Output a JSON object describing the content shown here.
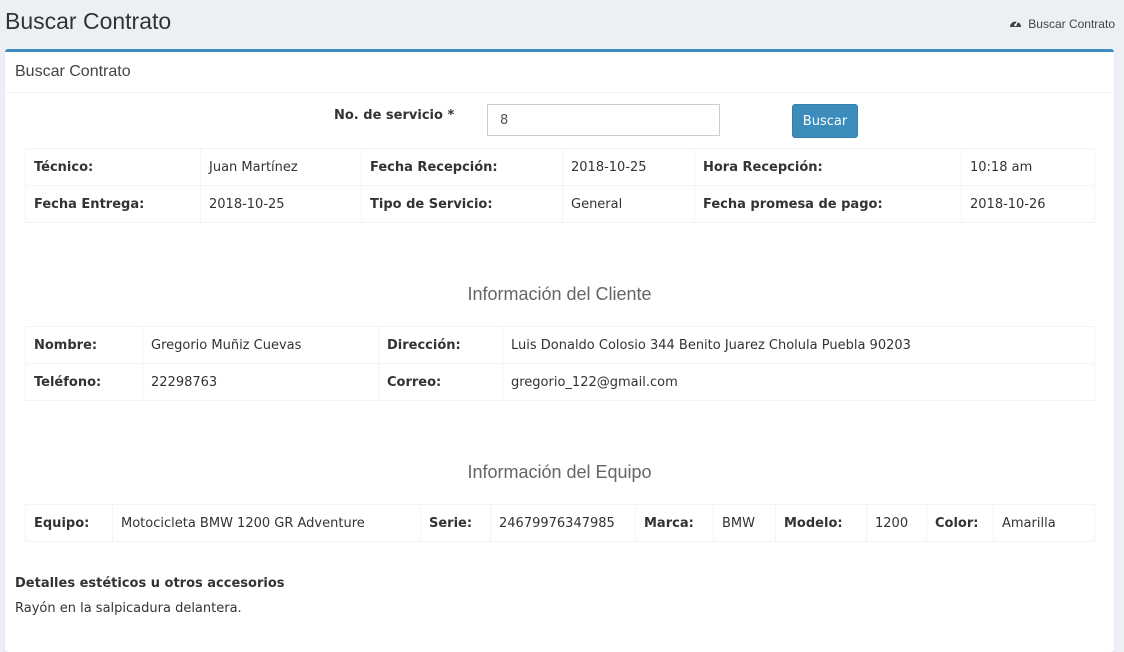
{
  "page": {
    "title": "Buscar Contrato",
    "breadcrumb": {
      "icon": "dashboard-icon",
      "label": "Buscar Contrato"
    }
  },
  "box": {
    "title": "Buscar Contrato"
  },
  "search": {
    "label": "No. de servicio *",
    "value": "8",
    "button_label": "Buscar"
  },
  "service": {
    "tecnico_label": "Técnico:",
    "tecnico": "Juan Martínez",
    "fecha_recepcion_label": "Fecha Recepción:",
    "fecha_recepcion": "2018-10-25",
    "hora_recepcion_label": "Hora Recepción:",
    "hora_recepcion": "10:18 am",
    "fecha_entrega_label": "Fecha Entrega:",
    "fecha_entrega": "2018-10-25",
    "tipo_servicio_label": "Tipo de Servicio:",
    "tipo_servicio": "General",
    "fecha_promesa_label": "Fecha promesa de pago:",
    "fecha_promesa": "2018-10-26"
  },
  "client": {
    "section_title": "Información del Cliente",
    "nombre_label": "Nombre:",
    "nombre": "Gregorio Muñiz Cuevas",
    "direccion_label": "Dirección:",
    "direccion": "Luis Donaldo Colosio 344 Benito Juarez Cholula Puebla 90203",
    "telefono_label": "Teléfono:",
    "telefono": "22298763",
    "correo_label": "Correo:",
    "correo": "gregorio_122@gmail.com"
  },
  "equipment": {
    "section_title": "Información del Equipo",
    "equipo_label": "Equipo:",
    "equipo": "Motocicleta BMW 1200 GR Adventure",
    "serie_label": "Serie:",
    "serie": "24679976347985",
    "marca_label": "Marca:",
    "marca": "BMW",
    "modelo_label": "Modelo:",
    "modelo": "1200",
    "color_label": "Color:",
    "color": "Amarilla"
  },
  "details": {
    "title": "Detalles estéticos u otros accesorios",
    "text": "Rayón en la salpicadura delantera."
  },
  "colors": {
    "accent": "#3c8dbc",
    "background": "#ecf0f5"
  }
}
